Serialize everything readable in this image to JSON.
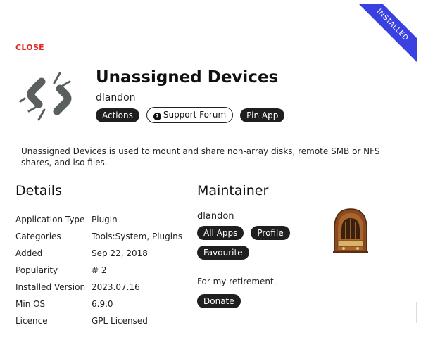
{
  "ribbon": {
    "label": "INSTALLED"
  },
  "close_label": "CLOSE",
  "app": {
    "title": "Unassigned Devices",
    "author": "dlandon",
    "buttons": {
      "actions": "Actions",
      "support": "Support Forum",
      "pin": "Pin App"
    },
    "description": "Unassigned Devices is used to mount and share non-array disks, remote SMB or NFS shares, and iso files."
  },
  "details": {
    "heading": "Details",
    "rows": [
      {
        "key": "Application Type",
        "value": "Plugin"
      },
      {
        "key": "Categories",
        "value": "Tools:System, Plugins"
      },
      {
        "key": "Added",
        "value": "Sep 22, 2018"
      },
      {
        "key": "Popularity",
        "value": "# 2"
      },
      {
        "key": "Installed Version",
        "value": "2023.07.16"
      },
      {
        "key": "Min OS",
        "value": "6.9.0"
      },
      {
        "key": "Licence",
        "value": "GPL Licensed"
      }
    ]
  },
  "maintainer": {
    "heading": "Maintainer",
    "name": "dlandon",
    "all_apps": "All Apps",
    "profile": "Profile",
    "favourite": "Favourite",
    "note": "For my retirement.",
    "donate": "Donate"
  },
  "colors": {
    "ribbon": "#3a41e0",
    "close": "#e22828",
    "pill": "#1f1f1f",
    "icon": "#5a5f5f"
  },
  "icons": {
    "app": "broken-link-icon",
    "support": "question-circle-icon",
    "maintainer_avatar": "vintage-radio-icon"
  }
}
